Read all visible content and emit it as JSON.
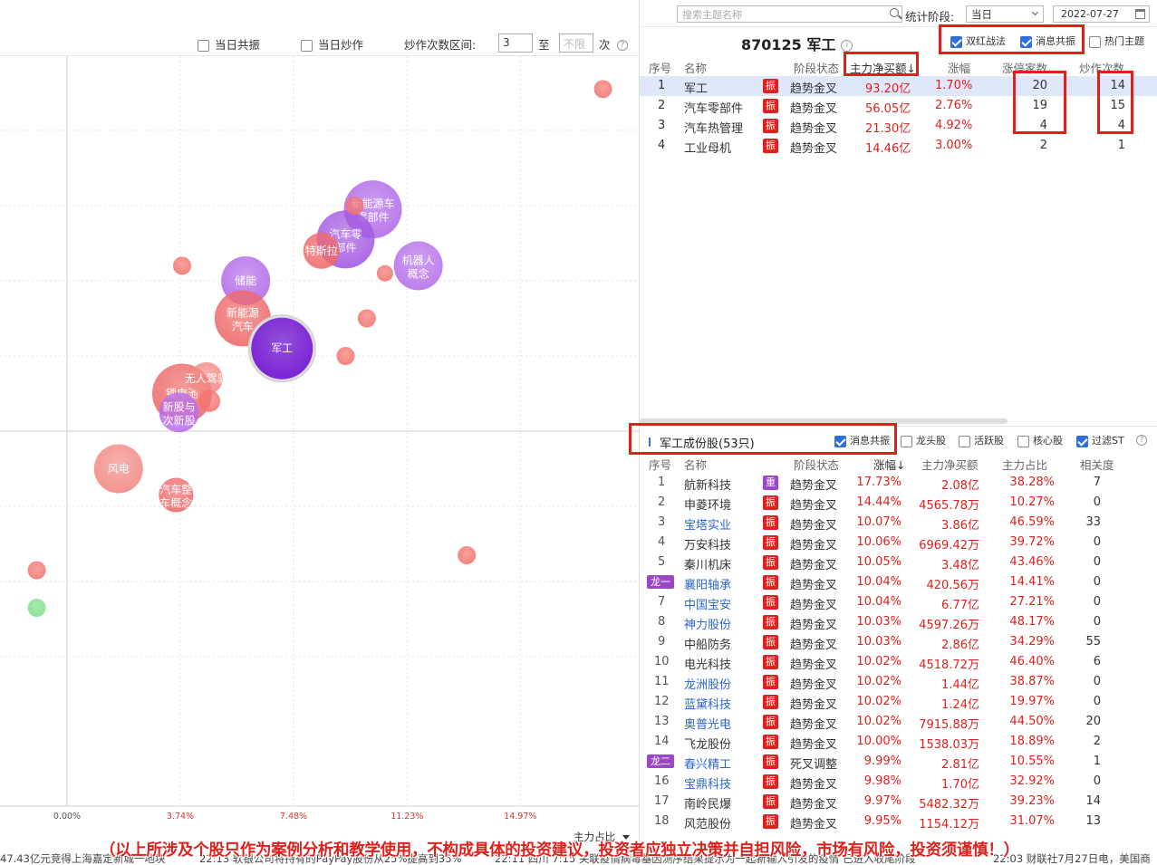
{
  "left_toolbar": {
    "chk_resonance": {
      "label": "当日共振",
      "checked": false
    },
    "chk_hype": {
      "label": "当日炒作",
      "checked": false
    },
    "range_label": "炒作次数区间:",
    "range_from": "3",
    "range_sep": "至",
    "range_to_placeholder": "不限",
    "range_unit": "次",
    "help": "?"
  },
  "chart_data": {
    "type": "scatter",
    "xlabel": "主力占比",
    "x_ticks": [
      "0.00%",
      "3.74%",
      "7.48%",
      "11.23%",
      "14.97%"
    ],
    "x_tick_values": [
      0,
      3.74,
      7.48,
      11.23,
      14.97
    ],
    "bubbles": [
      {
        "label": "",
        "x": 17.7,
        "y": 4.55,
        "r": 10,
        "color": "#f2756f"
      },
      {
        "label": "新能源车零部件",
        "x": 10.1,
        "y": 2.95,
        "r": 32,
        "color": "#b26be8"
      },
      {
        "label": "汽车零部件",
        "x": 9.2,
        "y": 2.55,
        "r": 32,
        "color": "#a45ae2"
      },
      {
        "label": "特斯拉",
        "x": 8.4,
        "y": 2.4,
        "r": 20,
        "color": "#ef6a6a"
      },
      {
        "label": "",
        "x": 9.5,
        "y": 3.0,
        "r": 10,
        "color": "#f2756f"
      },
      {
        "label": "机器人概念",
        "x": 11.6,
        "y": 2.2,
        "r": 27,
        "color": "#b771ea"
      },
      {
        "label": "",
        "x": 10.5,
        "y": 2.1,
        "r": 9,
        "color": "#f2756f"
      },
      {
        "label": "",
        "x": 3.8,
        "y": 2.2,
        "r": 10,
        "color": "#f2756f"
      },
      {
        "label": "储能",
        "x": 5.9,
        "y": 2.0,
        "r": 27,
        "color": "#b26be8"
      },
      {
        "label": "新能源汽车",
        "x": 5.8,
        "y": 1.5,
        "r": 31,
        "color": "#ef6a6a"
      },
      {
        "label": "",
        "x": 9.9,
        "y": 1.5,
        "r": 10,
        "color": "#f2756f"
      },
      {
        "label": "",
        "x": 9.2,
        "y": 1.0,
        "r": 10,
        "color": "#f2756f"
      },
      {
        "label": "锂电池",
        "x": 3.8,
        "y": 0.5,
        "r": 33,
        "color": "#ef6a6a"
      },
      {
        "label": "无人驾驶",
        "x": 4.6,
        "y": 0.7,
        "r": 18,
        "color": "#f28a85"
      },
      {
        "label": "",
        "x": 4.7,
        "y": 0.4,
        "r": 12,
        "color": "#f2756f"
      },
      {
        "label": "新股与次新股",
        "x": 3.7,
        "y": 0.25,
        "r": 22,
        "color": "#b771ea"
      },
      {
        "label": "风电",
        "x": 1.7,
        "y": -0.5,
        "r": 27,
        "color": "#f28a85"
      },
      {
        "label": "汽车整车概念",
        "x": 3.6,
        "y": -0.85,
        "r": 19,
        "color": "#ef6a6a"
      },
      {
        "label": "",
        "x": 13.2,
        "y": -1.65,
        "r": 10,
        "color": "#f2756f"
      },
      {
        "label": "",
        "x": -1.0,
        "y": -1.85,
        "r": 10,
        "color": "#f2756f"
      },
      {
        "label": "",
        "x": -1.0,
        "y": -2.35,
        "r": 10,
        "color": "#7fe08a"
      },
      {
        "label": "军工",
        "x": 7.1,
        "y": 1.1,
        "r": 34,
        "color": "#7a22d6",
        "highlight": true
      }
    ]
  },
  "topbar": {
    "search_placeholder": "搜索主题名称",
    "period_label": "统计阶段:",
    "period_value": "当日",
    "date": "2022-07-27"
  },
  "sector": {
    "title": "870125 军工",
    "info": "i",
    "opt_double_red": {
      "label": "双红战法",
      "checked": true
    },
    "opt_news": {
      "label": "消息共振",
      "checked": true
    },
    "opt_hot": {
      "label": "热门主题",
      "checked": false
    },
    "headers": [
      "序号",
      "名称",
      "阶段状态",
      "主力净买额↓",
      "涨幅",
      "涨停家数",
      "炒作次数"
    ],
    "rows": [
      {
        "no": "1",
        "name": "军工",
        "tag": "振",
        "state": "趋势金叉",
        "net": "93.20亿",
        "chg": "1.70%",
        "limit": "20",
        "hype": "14"
      },
      {
        "no": "2",
        "name": "汽车零部件",
        "tag": "振",
        "state": "趋势金叉",
        "net": "56.05亿",
        "chg": "2.76%",
        "limit": "19",
        "hype": "15"
      },
      {
        "no": "3",
        "name": "汽车热管理",
        "tag": "振",
        "state": "趋势金叉",
        "net": "21.30亿",
        "chg": "4.92%",
        "limit": "4",
        "hype": "4"
      },
      {
        "no": "4",
        "name": "工业母机",
        "tag": "振",
        "state": "趋势金叉",
        "net": "14.46亿",
        "chg": "3.00%",
        "limit": "2",
        "hype": "1"
      }
    ]
  },
  "components": {
    "title": "军工成份股(53只)",
    "opt_news": {
      "label": "消息共振",
      "checked": true
    },
    "opt_leader": {
      "label": "龙头股",
      "checked": false
    },
    "opt_active": {
      "label": "活跃股",
      "checked": false
    },
    "opt_core": {
      "label": "核心股",
      "checked": false
    },
    "opt_filter_st": {
      "label": "过滤ST",
      "checked": true
    },
    "help": "?",
    "headers": [
      "序号",
      "名称",
      "阶段状态",
      "涨幅↓",
      "主力净买额",
      "主力占比",
      "相关度"
    ],
    "rows": [
      {
        "no": "1",
        "name": "航新科技",
        "tag": "重",
        "state": "趋势金叉",
        "chg": "17.73%",
        "net": "2.08亿",
        "ratio": "38.28%",
        "rel": "7"
      },
      {
        "no": "2",
        "name": "申菱环境",
        "tag": "振",
        "state": "趋势金叉",
        "chg": "14.44%",
        "net": "4565.78万",
        "ratio": "10.27%",
        "rel": "0"
      },
      {
        "no": "3",
        "name": "宝塔实业",
        "tag": "振",
        "state": "趋势金叉",
        "chg": "10.07%",
        "net": "3.86亿",
        "ratio": "46.59%",
        "rel": "33",
        "blue": true
      },
      {
        "no": "4",
        "name": "万安科技",
        "tag": "振",
        "state": "趋势金叉",
        "chg": "10.06%",
        "net": "6969.42万",
        "ratio": "39.72%",
        "rel": "0"
      },
      {
        "no": "5",
        "name": "秦川机床",
        "tag": "振",
        "state": "趋势金叉",
        "chg": "10.05%",
        "net": "3.48亿",
        "ratio": "43.46%",
        "rel": "0"
      },
      {
        "no": "龙一",
        "name": "襄阳轴承",
        "tag": "振",
        "state": "趋势金叉",
        "chg": "10.04%",
        "net": "420.56万",
        "ratio": "14.41%",
        "rel": "0",
        "blue": true,
        "dragon": true
      },
      {
        "no": "7",
        "name": "中国宝安",
        "tag": "振",
        "state": "趋势金叉",
        "chg": "10.04%",
        "net": "6.77亿",
        "ratio": "27.21%",
        "rel": "0",
        "blue": true
      },
      {
        "no": "8",
        "name": "神力股份",
        "tag": "振",
        "state": "趋势金叉",
        "chg": "10.03%",
        "net": "4597.26万",
        "ratio": "48.17%",
        "rel": "0",
        "blue": true
      },
      {
        "no": "9",
        "name": "中船防务",
        "tag": "振",
        "state": "趋势金叉",
        "chg": "10.03%",
        "net": "2.86亿",
        "ratio": "34.29%",
        "rel": "55"
      },
      {
        "no": "10",
        "name": "电光科技",
        "tag": "振",
        "state": "趋势金叉",
        "chg": "10.02%",
        "net": "4518.72万",
        "ratio": "46.40%",
        "rel": "6"
      },
      {
        "no": "11",
        "name": "龙洲股份",
        "tag": "振",
        "state": "趋势金叉",
        "chg": "10.02%",
        "net": "1.44亿",
        "ratio": "38.87%",
        "rel": "0",
        "blue": true
      },
      {
        "no": "12",
        "name": "蓝黛科技",
        "tag": "振",
        "state": "趋势金叉",
        "chg": "10.02%",
        "net": "1.24亿",
        "ratio": "19.97%",
        "rel": "0",
        "blue": true
      },
      {
        "no": "13",
        "name": "奥普光电",
        "tag": "振",
        "state": "趋势金叉",
        "chg": "10.02%",
        "net": "7915.88万",
        "ratio": "44.50%",
        "rel": "20",
        "blue": true
      },
      {
        "no": "14",
        "name": "飞龙股份",
        "tag": "振",
        "state": "趋势金叉",
        "chg": "10.00%",
        "net": "1538.03万",
        "ratio": "18.89%",
        "rel": "2"
      },
      {
        "no": "龙二",
        "name": "春兴精工",
        "tag": "振",
        "state": "死叉调整",
        "chg": "9.99%",
        "net": "2.81亿",
        "ratio": "10.55%",
        "rel": "1",
        "blue": true,
        "dragon": true
      },
      {
        "no": "16",
        "name": "宝鼎科技",
        "tag": "振",
        "state": "趋势金叉",
        "chg": "9.98%",
        "net": "1.70亿",
        "ratio": "32.92%",
        "rel": "0",
        "blue": true
      },
      {
        "no": "17",
        "name": "南岭民爆",
        "tag": "振",
        "state": "趋势金叉",
        "chg": "9.97%",
        "net": "5482.32万",
        "ratio": "39.23%",
        "rel": "14"
      },
      {
        "no": "18",
        "name": "风范股份",
        "tag": "振",
        "state": "趋势金叉",
        "chg": "9.95%",
        "net": "1154.12万",
        "ratio": "31.07%",
        "rel": "13"
      }
    ]
  },
  "ticker": {
    "items": [
      "47.43亿元竞得上海嘉定新城一地块",
      "22:13 软银公司将持有的PayPay股份从25%提高到35%",
      "22:11 四川 7:15 关联疫情病毒基因测序结果提示为一起新输入引发的疫情 已进入收尾阶段",
      "22:03 财联社7月27日电，美国商"
    ]
  },
  "disclaimer": "（以上所涉及个股只作为案例分析和教学使用，不构成具体的投资建议，投资者应独立决策并自担风险，市场有风险，投资须谨慎！）"
}
